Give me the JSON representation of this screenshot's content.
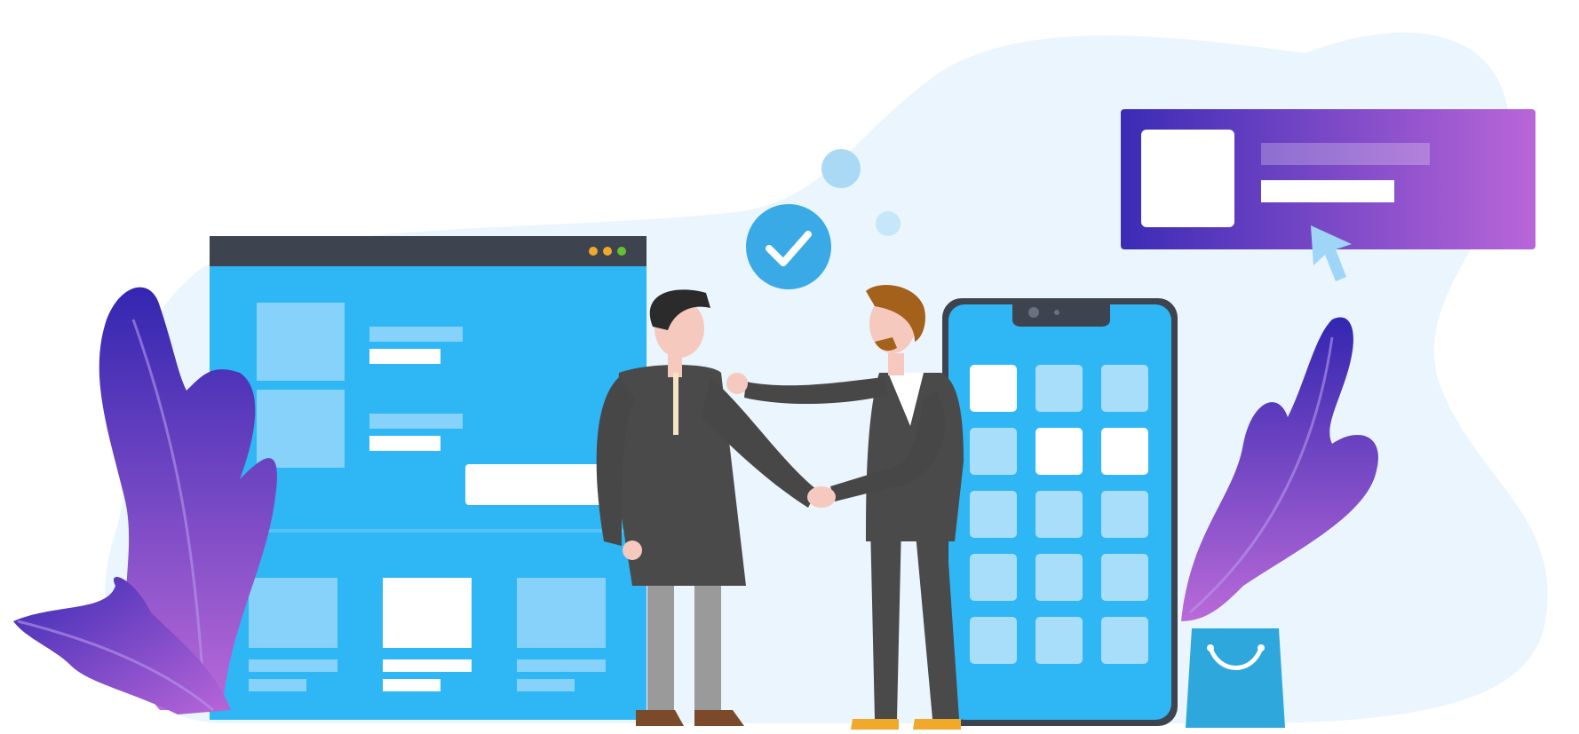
{
  "scene": {
    "description_visible_text": "",
    "colors": {
      "background_blob": "#eaf5fd",
      "browser_blue": "#2eb6f5",
      "browser_bar": "#3e4350",
      "phone_blue": "#2eb6f5",
      "phone_frame": "#3e4350",
      "tile_light": "#a9defa",
      "tile_white": "#ffffff",
      "check_circle": "#3aaae6",
      "banner_start": "#3b2bb5",
      "banner_end": "#b966d8",
      "leaf_start": "#3b2bb5",
      "leaf_end": "#b966d8",
      "bag_blue": "#2ea8dc",
      "suit_dark": "#4a4a4a",
      "skin": "#f6c9bf",
      "shoe_brown": "#7a4a2a",
      "shoe_gold": "#f0a92b",
      "window_dots": [
        "#f0a92b",
        "#f0a92b",
        "#63c132"
      ]
    },
    "icons": [
      "check-icon",
      "cursor-icon",
      "shopping-bag-icon",
      "window-control-dots"
    ]
  }
}
